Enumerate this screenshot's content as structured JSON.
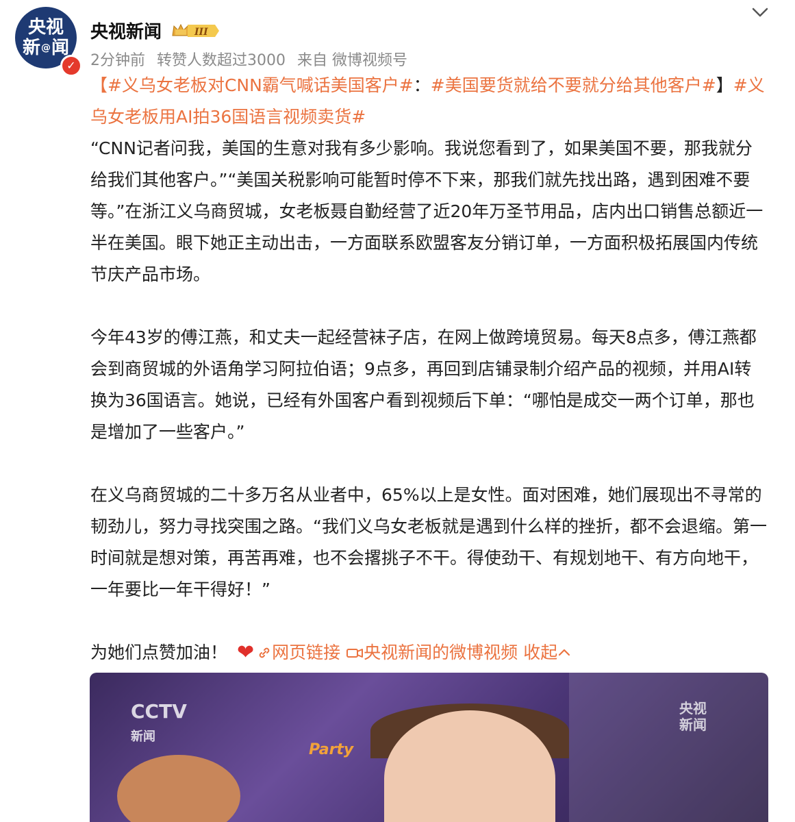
{
  "header": {
    "avatar_line1": "央视",
    "avatar_line2a": "新",
    "avatar_at": "@",
    "avatar_line2b": "闻",
    "verified_mark": "✓",
    "name": "央视新闻",
    "badge_level": "III",
    "time": "2分钟前",
    "shares": "转赞人数超过3000",
    "source": "来自 微博视频号"
  },
  "post": {
    "tag1": "【#义乌女老板对CNN霸气喊话美国客户#",
    "sep1": "：",
    "tag2": "#美国要货就给不要就分给其他客户#",
    "sep2": "】",
    "tag3": "#义乌女老板用AI拍36国语言视频卖货#",
    "para1": "“CNN记者问我，美国的生意对我有多少影响。我说您看到了，如果美国不要，那我就分给我们其他客户。”“美国关税影响可能暂时停不下来，那我们就先找出路，遇到困难不要等。”在浙江义乌商贸城，女老板聂自勤经营了近20年万圣节用品，店内出口销售总额近一半在美国。眼下她正主动出击，一方面联系欧盟客友分销订单，一方面积极拓展国内传统节庆产品市场。",
    "para2": "今年43岁的傅江燕，和丈夫一起经营袜子店，在网上做跨境贸易。每天8点多，傅江燕都会到商贸城的外语角学习阿拉伯语；9点多，再回到店铺录制介绍产品的视频，并用AI转换为36国语言。她说，已经有外国客户看到视频后下单：“哪怕是成交一两个订单，那也是增加了一些客户。”",
    "para3": "在义乌商贸城的二十多万名从业者中，65%以上是女性。面对困难，她们展现出不寻常的韧劲儿，努力寻找突围之路。“我们义乌女老板就是遇到什么样的挫折，都不会退缩。第一时间就是想对策，再苦再难，也不会撂挑子不干。得使劲干、有规划地干、有方向地干，一年要比一年干得好！”",
    "cta": "为她们点赞加油！",
    "heart": "❤",
    "web_link": "网页链接",
    "video_link": "央视新闻的微博视频",
    "collapse": "收起"
  },
  "video": {
    "cctv_logo": "CCTV",
    "cctv_sub": "新闻",
    "watermark1": "央视",
    "watermark2": "新闻",
    "sign_text": "Party"
  },
  "colors": {
    "accent": "#eb7340",
    "text": "#222222",
    "meta": "#8a8a8a",
    "verified": "#e43a2c"
  }
}
